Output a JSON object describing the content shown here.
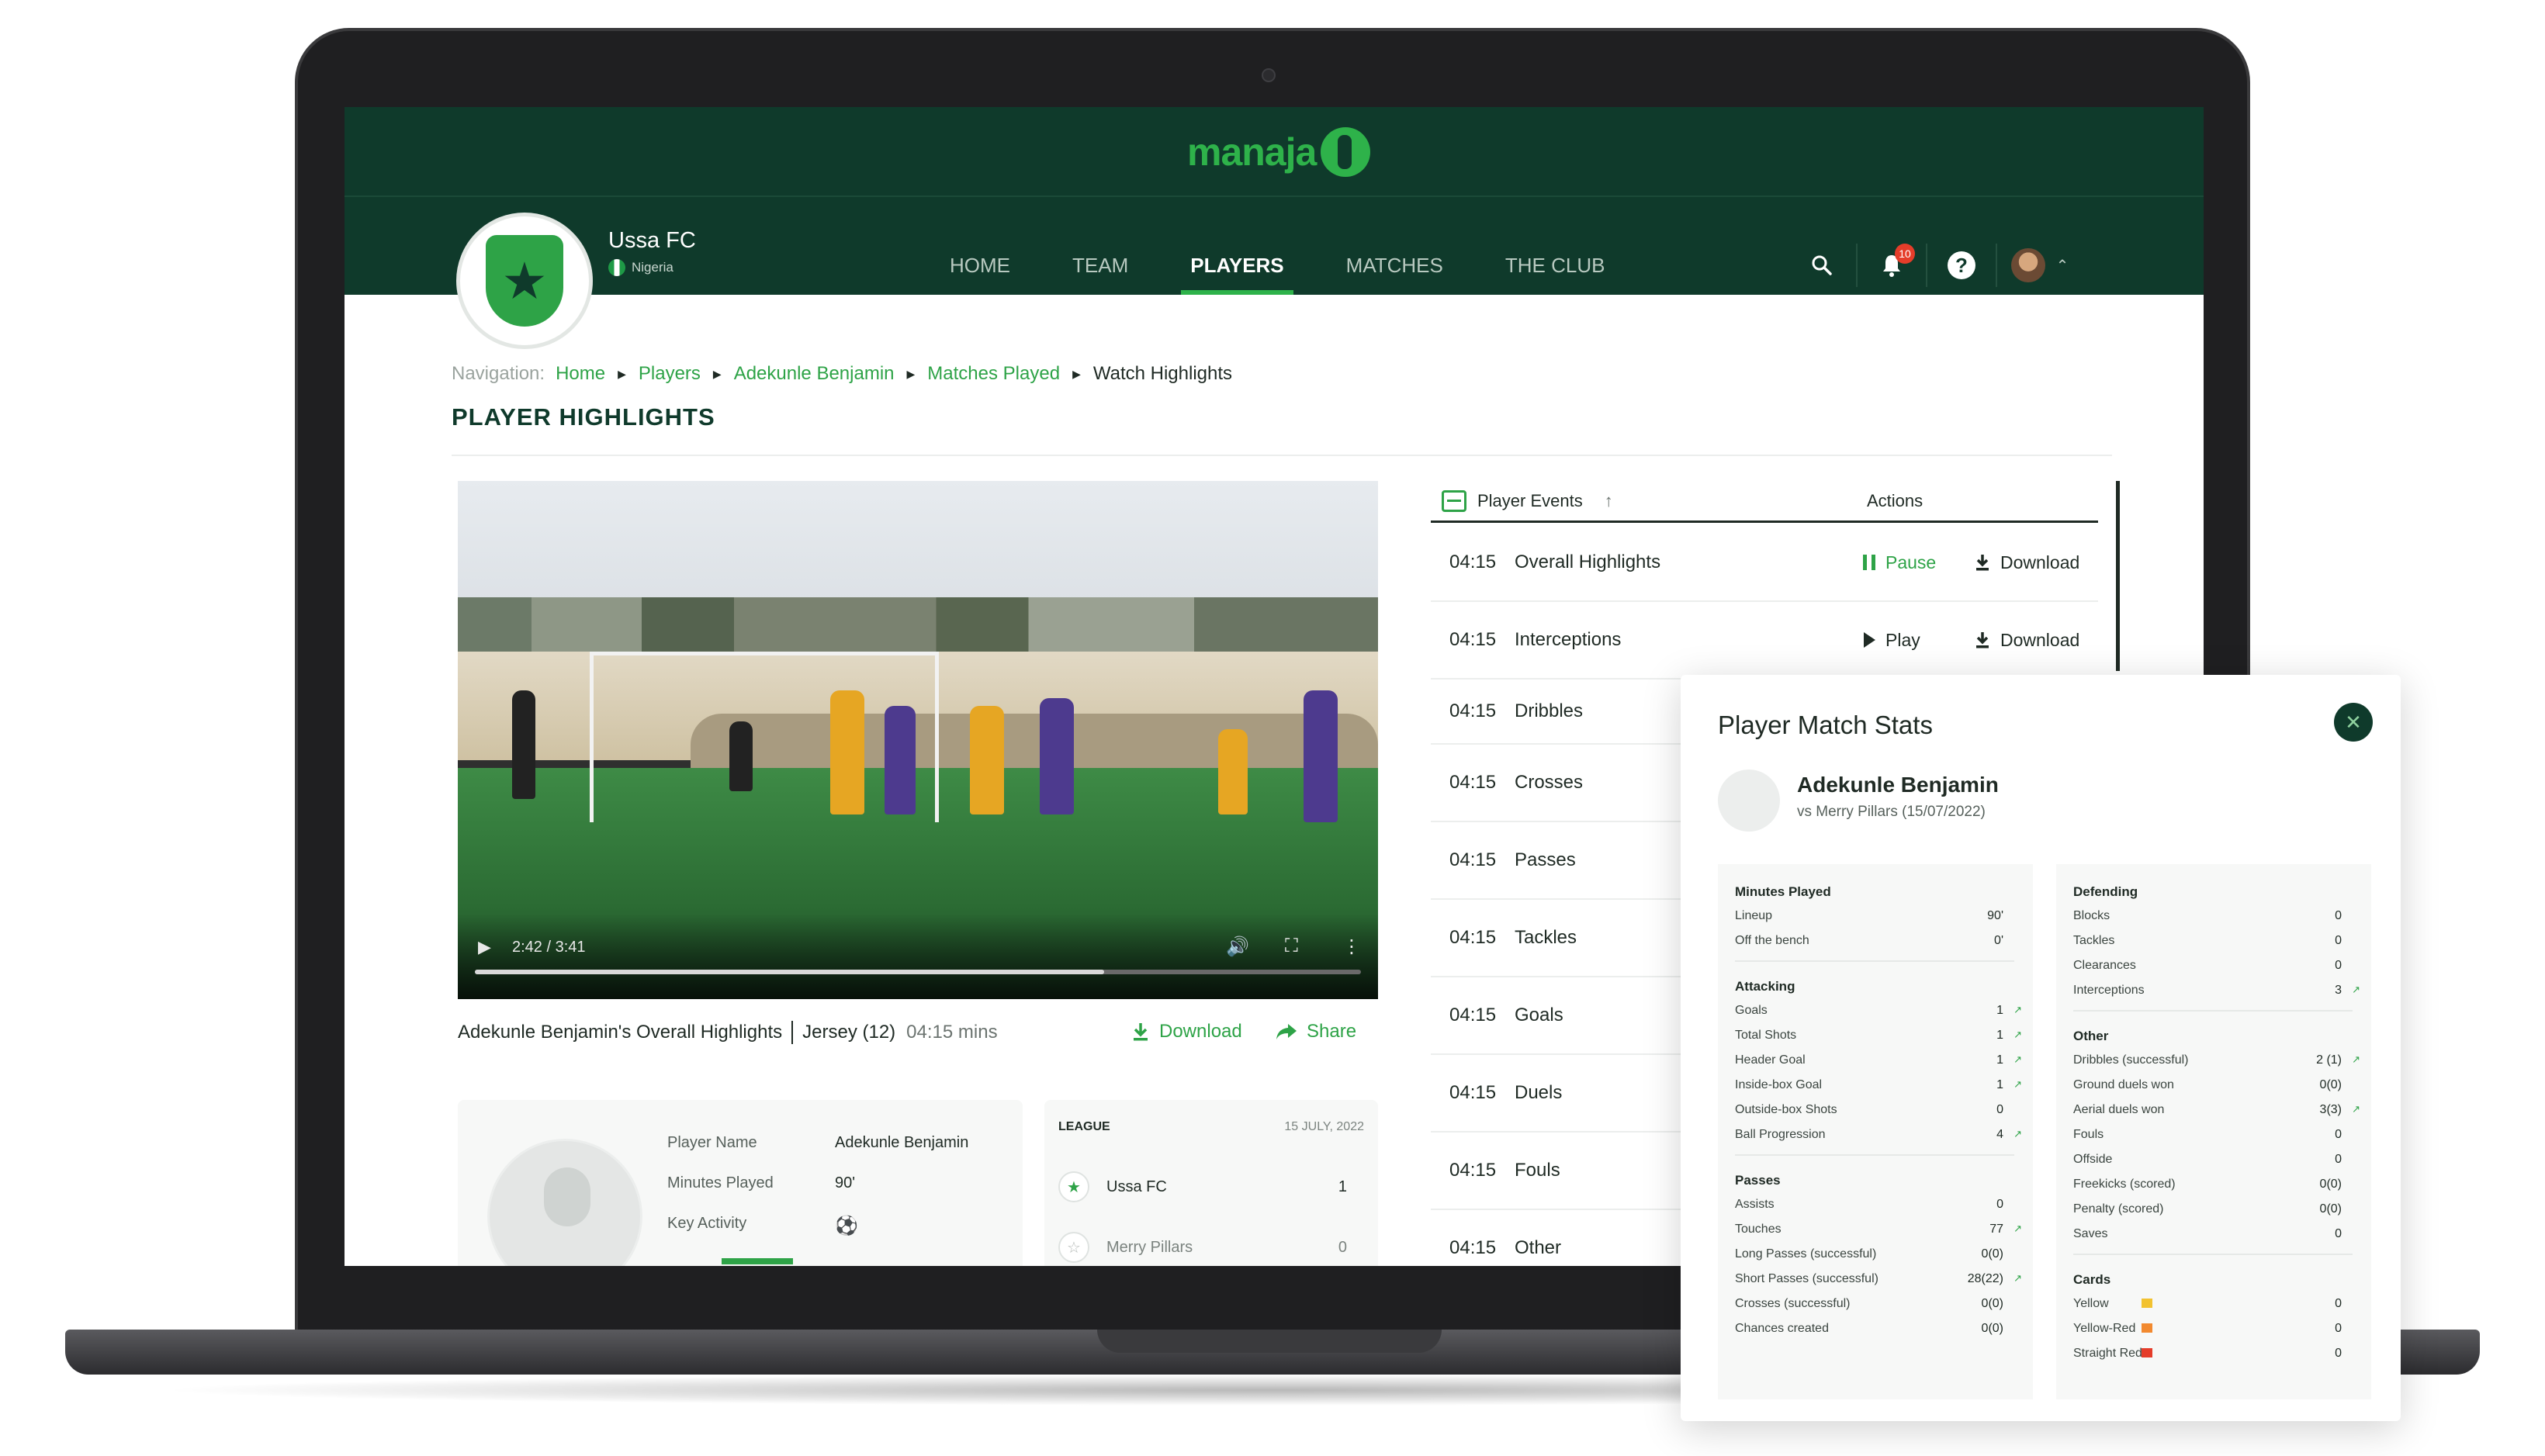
{
  "app": {
    "logo_text": "manaja"
  },
  "club": {
    "name": "Ussa FC",
    "country": "Nigeria"
  },
  "nav": {
    "items": [
      "HOME",
      "TEAM",
      "PLAYERS",
      "MATCHES",
      "THE CLUB"
    ],
    "active": "PLAYERS"
  },
  "tools": {
    "notifications_count": "10"
  },
  "breadcrumb": {
    "label": "Navigation:",
    "items": [
      "Home",
      "Players",
      "Adekunle Benjamin",
      "Matches Played",
      "Watch Highlights"
    ]
  },
  "page_title": "PLAYER HIGHLIGHTS",
  "video": {
    "time": "2:42 / 3:41",
    "progress": 0.71,
    "caption_title": "Adekunle Benjamin's Overall Highlights",
    "caption_jersey": "Jersey (12)",
    "caption_duration": "04:15 mins",
    "download_label": "Download",
    "share_label": "Share"
  },
  "player_info": {
    "rows": [
      {
        "key": "Player Name",
        "value": "Adekunle Benjamin"
      },
      {
        "key": "Minutes Played",
        "value": "90'"
      },
      {
        "key": "Key Activity",
        "value": ""
      }
    ]
  },
  "league": {
    "label": "LEAGUE",
    "date": "15 JULY, 2022",
    "teams": [
      {
        "name": "Ussa FC",
        "score": "1"
      },
      {
        "name": "Merry Pillars",
        "score": "0"
      }
    ]
  },
  "events": {
    "header": "Player Events",
    "actions_header": "Actions",
    "rows": [
      {
        "time": "04:15",
        "name": "Overall Highlights",
        "state": "Pause",
        "download": "Download"
      },
      {
        "time": "04:15",
        "name": "Interceptions",
        "state": "Play",
        "download": "Download"
      },
      {
        "time": "04:15",
        "name": "Dribbles"
      },
      {
        "time": "04:15",
        "name": "Crosses"
      },
      {
        "time": "04:15",
        "name": "Passes"
      },
      {
        "time": "04:15",
        "name": "Tackles"
      },
      {
        "time": "04:15",
        "name": "Goals"
      },
      {
        "time": "04:15",
        "name": "Duels"
      },
      {
        "time": "04:15",
        "name": "Fouls"
      },
      {
        "time": "04:15",
        "name": "Other"
      }
    ]
  },
  "stats": {
    "title": "Player Match Stats",
    "player": "Adekunle Benjamin",
    "match": "vs Merry Pillars (15/07/2022)",
    "left": [
      {
        "title": "Minutes Played",
        "rows": [
          {
            "name": "Lineup",
            "value": "90'"
          },
          {
            "name": "Off the bench",
            "value": "0'"
          }
        ]
      },
      {
        "title": "Attacking",
        "rows": [
          {
            "name": "Goals",
            "value": "1",
            "up": true
          },
          {
            "name": "Total Shots",
            "value": "1",
            "up": true
          },
          {
            "name": "Header Goal",
            "value": "1",
            "up": true
          },
          {
            "name": "Inside-box Goal",
            "value": "1",
            "up": true
          },
          {
            "name": "Outside-box Shots",
            "value": "0"
          },
          {
            "name": "Ball Progression",
            "value": "4",
            "up": true
          }
        ]
      },
      {
        "title": "Passes",
        "rows": [
          {
            "name": "Assists",
            "value": "0"
          },
          {
            "name": "Touches",
            "value": "77",
            "up": true
          },
          {
            "name": "Long Passes (successful)",
            "value": "0(0)"
          },
          {
            "name": "Short Passes (successful)",
            "value": "28(22)",
            "up": true
          },
          {
            "name": "Crosses (successful)",
            "value": "0(0)"
          },
          {
            "name": "Chances created",
            "value": "0(0)"
          }
        ]
      }
    ],
    "right": [
      {
        "title": "Defending",
        "rows": [
          {
            "name": "Blocks",
            "value": "0"
          },
          {
            "name": "Tackles",
            "value": "0"
          },
          {
            "name": "Clearances",
            "value": "0"
          },
          {
            "name": "Interceptions",
            "value": "3",
            "up": true
          }
        ]
      },
      {
        "title": "Other",
        "rows": [
          {
            "name": "Dribbles (successful)",
            "value": "2 (1)",
            "up": true
          },
          {
            "name": "Ground duels won",
            "value": "0(0)"
          },
          {
            "name": "Aerial duels won",
            "value": "3(3)",
            "up": true
          },
          {
            "name": "Fouls",
            "value": "0"
          },
          {
            "name": "Offside",
            "value": "0"
          },
          {
            "name": "Freekicks (scored)",
            "value": "0(0)"
          },
          {
            "name": "Penalty (scored)",
            "value": "0(0)"
          },
          {
            "name": "Saves",
            "value": "0"
          }
        ]
      },
      {
        "title": "Cards",
        "rows": [
          {
            "name": "Yellow",
            "value": "0",
            "card": "yellow"
          },
          {
            "name": "Yellow-Red",
            "value": "0",
            "card": "yellow-red"
          },
          {
            "name": "Straight Red",
            "value": "0",
            "card": "red"
          }
        ]
      }
    ]
  },
  "colors": {
    "brand_dark": "#0f3a2b",
    "accent": "#2ea347",
    "alert": "#e53d2a"
  },
  "icons": [
    "search-icon",
    "bell-icon",
    "help-icon",
    "chevron-up-icon",
    "play-icon",
    "pause-icon",
    "download-icon",
    "share-icon",
    "volume-icon",
    "fullscreen-icon",
    "more-icon",
    "sort-icon",
    "close-icon",
    "star-icon",
    "whistle-icon"
  ]
}
